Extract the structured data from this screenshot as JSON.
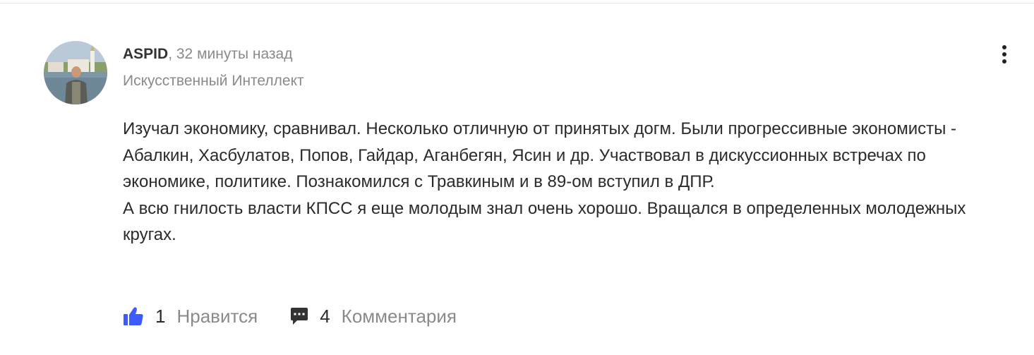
{
  "comment": {
    "author": "ASPID",
    "separator": ",",
    "time": "32 минуты назад",
    "subtitle": "Искусственный Интеллект",
    "paragraphs": [
      "Изучал экономику, сравнивал. Несколько отличную от принятых догм. Были прогрессивные экономисты - Абалкин, Хасбулатов, Попов, Гайдар, Аганбегян, Ясин и др. Участвовал в дискуссионных встречах по экономике, политике. Познакомился с Травкиным и в 89-ом вступил в ДПР.",
      "А всю гнилость власти КПСС я еще молодым знал очень хорошо. Вращался в определенных молодежных кругах."
    ],
    "likes": {
      "count": "1",
      "label": "Нравится",
      "icon": "thumbs-up-icon",
      "color": "#3d5afe"
    },
    "comments": {
      "count": "4",
      "label": "Комментария",
      "icon": "chat-bubble-icon"
    },
    "menu_icon": "more-vertical-icon"
  }
}
